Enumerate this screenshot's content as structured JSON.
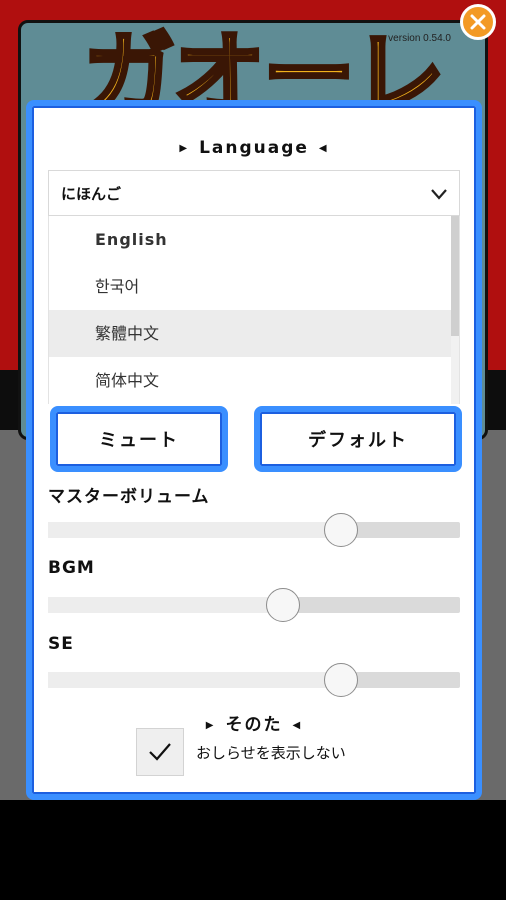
{
  "background": {
    "version": "version 0.54.0",
    "logo_text": "ガオーレ"
  },
  "close_button": {
    "icon": "close-icon",
    "color": "#f39a25"
  },
  "dialog": {
    "accent": "#3a8fff",
    "language": {
      "heading": "Language",
      "selected": "にほんご",
      "options": [
        "English",
        "한국어",
        "繁體中文",
        "简体中文"
      ],
      "highlighted_option": "繁體中文"
    },
    "buttons": {
      "mute": "ミュート",
      "default": "デフォルト"
    },
    "sliders": [
      {
        "label": "マスターボリューム",
        "value": 0.71
      },
      {
        "label": "BGM",
        "value": 0.57
      },
      {
        "label": "SE",
        "value": 0.71
      }
    ],
    "other": {
      "heading": "そのた",
      "notice_checkbox_label": "おしらせを表示しない",
      "notice_checked": true
    }
  }
}
